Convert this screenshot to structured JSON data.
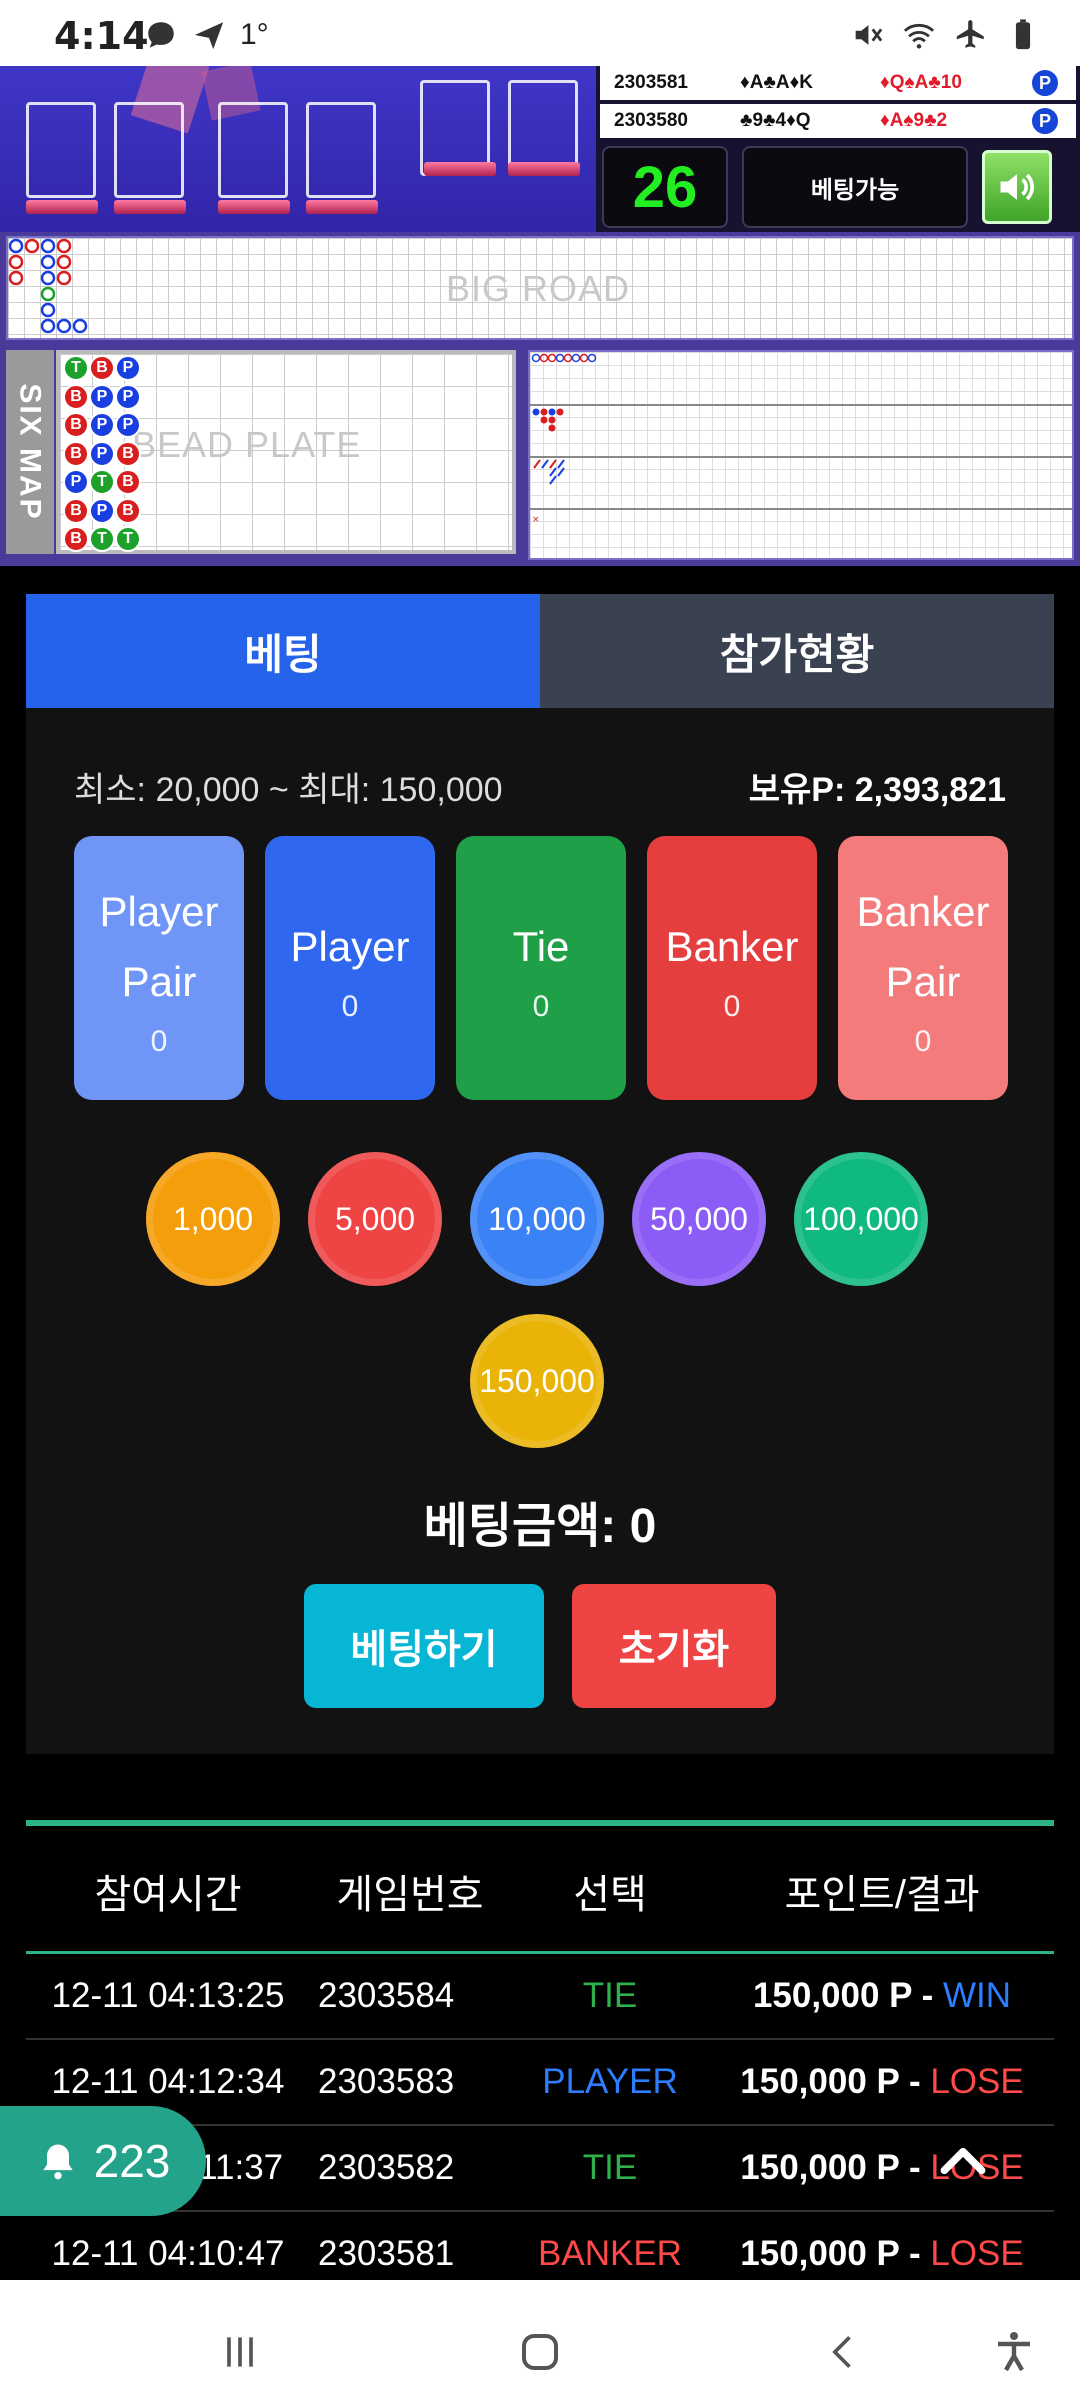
{
  "status_bar": {
    "time": "4:14",
    "extra": "1°",
    "icons": [
      "chat-bubble-icon",
      "send-icon",
      "mute-icon",
      "wifi-icon",
      "airplane-icon",
      "battery-icon"
    ]
  },
  "game": {
    "history": [
      {
        "round": "2303581",
        "player_cards": "♦A♣A♦K",
        "banker_cards": "♦Q♠A♣10",
        "badge": "P"
      },
      {
        "round": "2303580",
        "player_cards": "♣9♣4♦Q",
        "banker_cards": "♦A♠9♣2",
        "badge": "P"
      }
    ],
    "timer": "26",
    "status": "베팅가능",
    "big_road_label": "BIG ROAD",
    "six_map_label": "SIX MAP",
    "bead_plate_label": "BEAD PLATE",
    "bead_plate": [
      [
        "T",
        "B",
        "B",
        "B",
        "P",
        "B",
        "B"
      ],
      [
        "B",
        "P",
        "P",
        "P",
        "T",
        "P",
        "T"
      ],
      [
        "P",
        "P",
        "P",
        "B",
        "B",
        "B",
        "T"
      ]
    ]
  },
  "tabs": [
    {
      "label": "베팅",
      "active": true
    },
    {
      "label": "참가현황",
      "active": false
    }
  ],
  "limits": "최소: 20,000 ~ 최대: 150,000",
  "balance": "보유P: 2,393,821",
  "bet_options": [
    {
      "line1": "Player",
      "line2": "Pair",
      "amount": "0",
      "color": "#6f96f7"
    },
    {
      "line1": "Player",
      "line2": "",
      "amount": "0",
      "color": "#2f68ee"
    },
    {
      "line1": "Tie",
      "line2": "",
      "amount": "0",
      "color": "#1e9f48"
    },
    {
      "line1": "Banker",
      "line2": "",
      "amount": "0",
      "color": "#e53e3e"
    },
    {
      "line1": "Banker",
      "line2": "Pair",
      "amount": "0",
      "color": "#f47b7b"
    }
  ],
  "chips": [
    {
      "label": "1,000",
      "color": "#f59e0b"
    },
    {
      "label": "5,000",
      "color": "#ef4444"
    },
    {
      "label": "10,000",
      "color": "#3b82f6"
    },
    {
      "label": "50,000",
      "color": "#8b5cf6"
    },
    {
      "label": "100,000",
      "color": "#10b981"
    },
    {
      "label": "150,000",
      "color": "#eab308"
    }
  ],
  "bet_total": "베팅금액: 0",
  "buttons": {
    "place_bet": "베팅하기",
    "reset": "초기화"
  },
  "history_table": {
    "headers": [
      "참여시간",
      "게임번호",
      "선택",
      "포인트/결과"
    ],
    "rows": [
      {
        "time": "12-11 04:13:25",
        "game": "2303584",
        "choice": "TIE",
        "points": "150,000 P - ",
        "result": "WIN"
      },
      {
        "time": "12-11 04:12:34",
        "game": "2303583",
        "choice": "PLAYER",
        "points": "150,000 P - ",
        "result": "LOSE"
      },
      {
        "time": "12-11 04:11:37",
        "game": "2303582",
        "choice": "TIE",
        "points": "150,000 P - ",
        "result": "LOSE"
      },
      {
        "time": "12-11 04:10:47",
        "game": "2303581",
        "choice": "BANKER",
        "points": "150,000 P - ",
        "result": "LOSE"
      }
    ]
  },
  "notification": {
    "count": "223"
  }
}
